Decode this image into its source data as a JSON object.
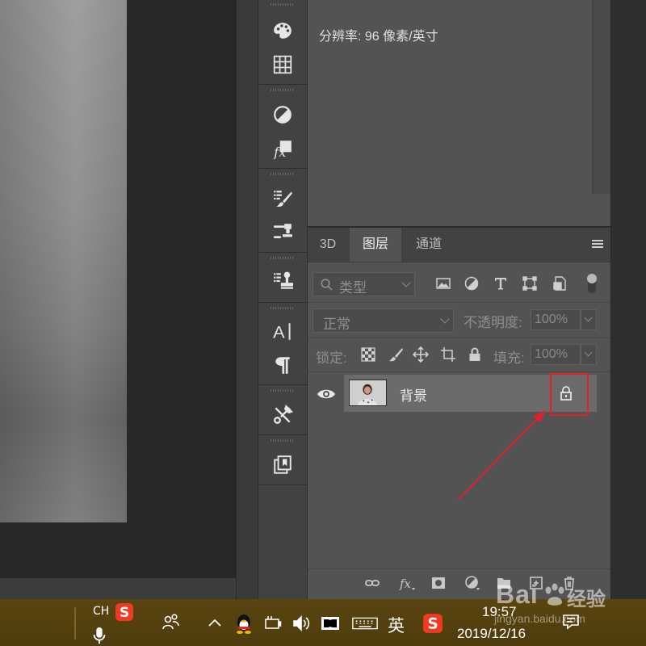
{
  "info": {
    "resolution": "分辨率: 96 像素/英寸"
  },
  "tabs": [
    {
      "label": "3D"
    },
    {
      "label": "图层"
    },
    {
      "label": "通道"
    }
  ],
  "filter": {
    "kind_placeholder": "类型"
  },
  "blend": {
    "mode": "正常",
    "opacity_label": "不透明度:",
    "opacity_value": "100%"
  },
  "lock": {
    "label": "锁定:",
    "fill_label": "填充:",
    "fill_value": "100%"
  },
  "layers": [
    {
      "name": "背景",
      "locked": true,
      "visible": true
    }
  ],
  "taskbar": {
    "lang": "CH",
    "ime": "英",
    "time": "19:57",
    "date": "2019/12/16"
  },
  "watermark": {
    "brand": "Bai",
    "text": "经验",
    "url": "jingyan.baidu.com"
  },
  "colors": {
    "highlight": "#e0202a",
    "panel_bg": "#535353",
    "taskbar_bg": "#53400e"
  },
  "toolbar_icons": [
    "color-palette-icon",
    "swatches-grid-icon",
    "adjustments-icon",
    "fx-styles-icon",
    "brush-presets-icon",
    "tool-presets-icon",
    "clone-source-icon",
    "character-icon",
    "paragraph-icon",
    "tools-icon",
    "layer-comps-icon"
  ]
}
